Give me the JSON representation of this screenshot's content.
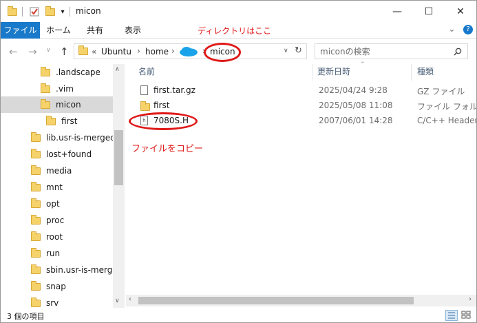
{
  "window": {
    "title": "micon",
    "minimize": "—",
    "maximize": "☐",
    "close": "✕"
  },
  "ribbon": {
    "tabs": [
      "ファイル",
      "ホーム",
      "共有",
      "表示"
    ],
    "expand": "⌄",
    "help": "?"
  },
  "annotations": {
    "directory_note": "ディレクトリはここ",
    "copy_note": "ファイルをコピー",
    "color": "#e01818"
  },
  "address": {
    "overflow": "«",
    "crumbs": [
      "Ubuntu",
      "home",
      "micon"
    ],
    "chevron": "›",
    "dropdown": "∨",
    "refresh": "↻"
  },
  "search": {
    "placeholder": "miconの検索"
  },
  "nav": {
    "items": [
      ".landscape",
      ".vim",
      "micon",
      "first",
      "lib.usr-is-merged",
      "lost+found",
      "media",
      "mnt",
      "opt",
      "proc",
      "root",
      "run",
      "sbin.usr-is-merged",
      "snap",
      "srv"
    ],
    "selected": "micon"
  },
  "columns": {
    "name": "名前",
    "modified": "更新日時",
    "type": "種類"
  },
  "files": [
    {
      "name": "first.tar.gz",
      "modified": "2025/04/24 9:28",
      "type": "GZ ファイル",
      "icon": "file-icon"
    },
    {
      "name": "first",
      "modified": "2025/05/08 11:08",
      "type": "ファイル フォルダー",
      "icon": "folder-icon"
    },
    {
      "name": "7080S.H",
      "modified": "2007/06/01 14:28",
      "type": "C/C++ Header",
      "icon": "header-file-icon"
    }
  ],
  "status": {
    "count": "3 個の項目"
  },
  "colors": {
    "accent": "#1979ca",
    "folder": "#f6d26b",
    "cloud": "#1aa3e8"
  }
}
